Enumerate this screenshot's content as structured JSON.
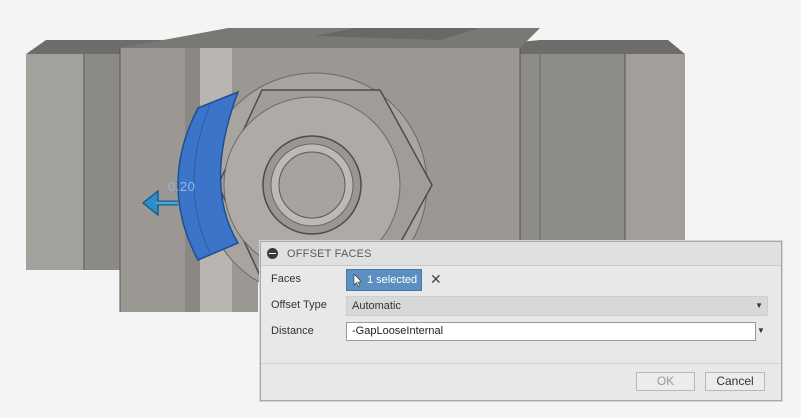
{
  "viewport": {
    "dimension_value": "0.20",
    "highlight_color": "#3b74c9"
  },
  "dialog": {
    "title": "OFFSET FACES",
    "rows": {
      "faces": {
        "label": "Faces",
        "selection": "1 selected"
      },
      "offset_type": {
        "label": "Offset Type",
        "value": "Automatic"
      },
      "distance": {
        "label": "Distance",
        "value": "-GapLooseInternal"
      }
    },
    "buttons": {
      "ok": "OK",
      "cancel": "Cancel"
    }
  },
  "icons": {
    "collapse": "collapse-icon",
    "cursor": "cursor-arrow-icon",
    "clear": "clear-x-icon",
    "dropdown": "chevron-down-icon",
    "drag_arrow": "arrow-left-icon"
  }
}
